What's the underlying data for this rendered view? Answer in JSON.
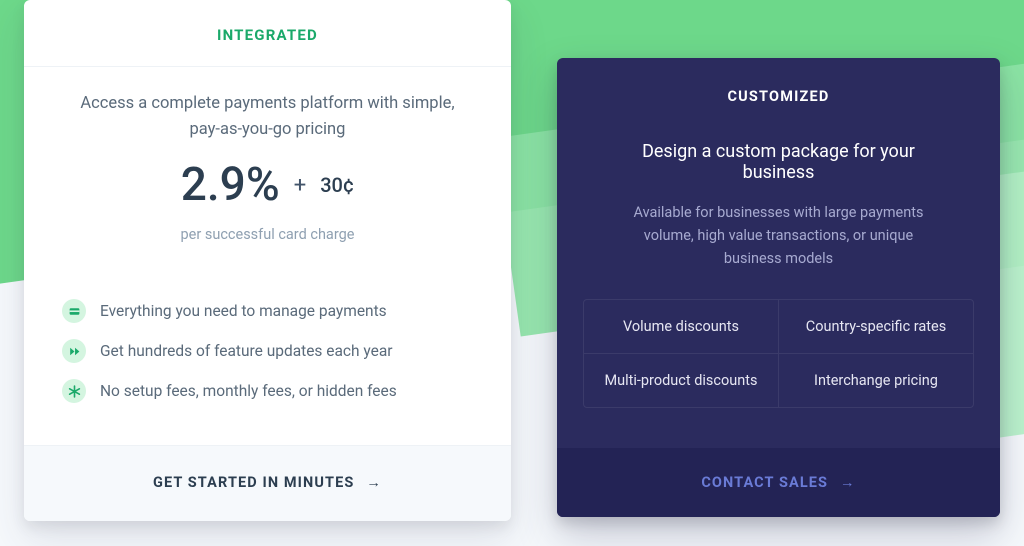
{
  "integrated": {
    "title": "INTEGRATED",
    "lead": "Access a complete payments platform with simple, pay-as-you-go pricing",
    "pct": "2.9%",
    "plus": "+",
    "cents": "30¢",
    "per": "per successful card charge",
    "features": [
      "Everything you need to manage payments",
      "Get hundreds of feature updates each year",
      "No setup fees, monthly fees, or hidden fees"
    ],
    "cta": "GET STARTED IN MINUTES"
  },
  "custom": {
    "title": "CUSTOMIZED",
    "lead": "Design a custom package for your business",
    "sub": "Available for businesses with large payments volume, high value transactions, or unique business models",
    "cells": [
      "Volume discounts",
      "Country-specific rates",
      "Multi-product discounts",
      "Interchange pricing"
    ],
    "cta": "CONTACT SALES"
  },
  "ui": {
    "arrow": "→"
  },
  "colors": {
    "accent_green": "#1ba96a",
    "dark_card": "#2b2b5e",
    "dark_cta_bg": "#232355",
    "dark_cta_text": "#6a7bd6"
  }
}
